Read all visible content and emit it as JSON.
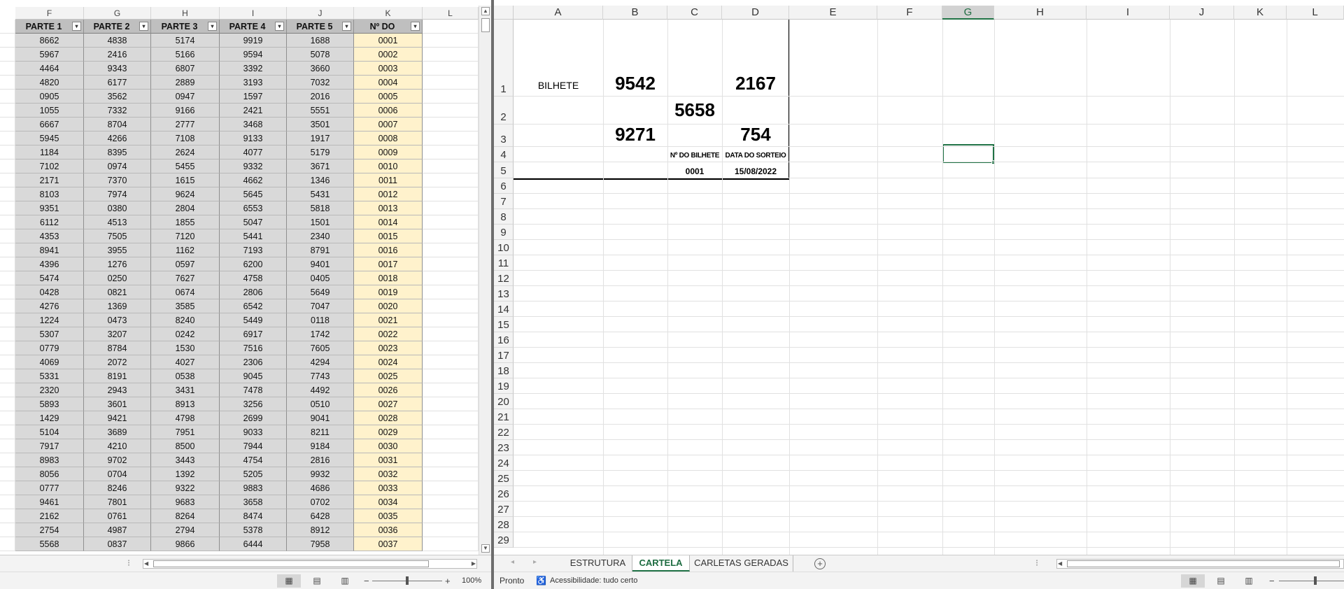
{
  "left_pane": {
    "columns": [
      "F",
      "G",
      "H",
      "I",
      "J",
      "K",
      "L"
    ],
    "headers": [
      "PARTE 1",
      "PARTE 2",
      "PARTE 3",
      "PARTE 4",
      "PARTE 5",
      "Nº DO BILHETE"
    ],
    "filter_glyph": "▾",
    "rows": [
      [
        "8662",
        "4838",
        "5174",
        "9919",
        "1688",
        "0001"
      ],
      [
        "5967",
        "2416",
        "5166",
        "9594",
        "5078",
        "0002"
      ],
      [
        "4464",
        "9343",
        "6807",
        "3392",
        "3660",
        "0003"
      ],
      [
        "4820",
        "6177",
        "2889",
        "3193",
        "7032",
        "0004"
      ],
      [
        "0905",
        "3562",
        "0947",
        "1597",
        "2016",
        "0005"
      ],
      [
        "1055",
        "7332",
        "9166",
        "2421",
        "5551",
        "0006"
      ],
      [
        "6667",
        "8704",
        "2777",
        "3468",
        "3501",
        "0007"
      ],
      [
        "5945",
        "4266",
        "7108",
        "9133",
        "1917",
        "0008"
      ],
      [
        "1184",
        "8395",
        "2624",
        "4077",
        "5179",
        "0009"
      ],
      [
        "7102",
        "0974",
        "5455",
        "9332",
        "3671",
        "0010"
      ],
      [
        "2171",
        "7370",
        "1615",
        "4662",
        "1346",
        "0011"
      ],
      [
        "8103",
        "7974",
        "9624",
        "5645",
        "5431",
        "0012"
      ],
      [
        "9351",
        "0380",
        "2804",
        "6553",
        "5818",
        "0013"
      ],
      [
        "6112",
        "4513",
        "1855",
        "5047",
        "1501",
        "0014"
      ],
      [
        "4353",
        "7505",
        "7120",
        "5441",
        "2340",
        "0015"
      ],
      [
        "8941",
        "3955",
        "1162",
        "7193",
        "8791",
        "0016"
      ],
      [
        "4396",
        "1276",
        "0597",
        "6200",
        "9401",
        "0017"
      ],
      [
        "5474",
        "0250",
        "7627",
        "4758",
        "0405",
        "0018"
      ],
      [
        "0428",
        "0821",
        "0674",
        "2806",
        "5649",
        "0019"
      ],
      [
        "4276",
        "1369",
        "3585",
        "6542",
        "7047",
        "0020"
      ],
      [
        "1224",
        "0473",
        "8240",
        "5449",
        "0118",
        "0021"
      ],
      [
        "5307",
        "3207",
        "0242",
        "6917",
        "1742",
        "0022"
      ],
      [
        "0779",
        "8784",
        "1530",
        "7516",
        "7605",
        "0023"
      ],
      [
        "4069",
        "2072",
        "4027",
        "2306",
        "4294",
        "0024"
      ],
      [
        "5331",
        "8191",
        "0538",
        "9045",
        "7743",
        "0025"
      ],
      [
        "2320",
        "2943",
        "3431",
        "7478",
        "4492",
        "0026"
      ],
      [
        "5893",
        "3601",
        "8913",
        "3256",
        "0510",
        "0027"
      ],
      [
        "1429",
        "9421",
        "4798",
        "2699",
        "9041",
        "0028"
      ],
      [
        "5104",
        "3689",
        "7951",
        "9033",
        "8211",
        "0029"
      ],
      [
        "7917",
        "4210",
        "8500",
        "7944",
        "9184",
        "0030"
      ],
      [
        "8983",
        "9702",
        "3443",
        "4754",
        "2816",
        "0031"
      ],
      [
        "8056",
        "0704",
        "1392",
        "5205",
        "9932",
        "0032"
      ],
      [
        "0777",
        "8246",
        "9322",
        "9883",
        "4686",
        "0033"
      ],
      [
        "9461",
        "7801",
        "9683",
        "3658",
        "0702",
        "0034"
      ],
      [
        "2162",
        "0761",
        "8264",
        "8474",
        "6428",
        "0035"
      ],
      [
        "2754",
        "4987",
        "2794",
        "5378",
        "8912",
        "0036"
      ],
      [
        "5568",
        "0837",
        "9866",
        "6444",
        "7958",
        "0037"
      ]
    ],
    "zoom_label": "100%",
    "zoom_value": 100
  },
  "right_pane": {
    "columns": [
      "A",
      "B",
      "C",
      "D",
      "E",
      "F",
      "G",
      "H",
      "I",
      "J",
      "K",
      "L"
    ],
    "selected_column": "G",
    "rows": [
      "1",
      "2",
      "3",
      "4",
      "5",
      "6",
      "7",
      "8",
      "9",
      "10",
      "11",
      "12",
      "13",
      "14",
      "15",
      "16",
      "17",
      "18",
      "19",
      "20",
      "21",
      "22",
      "23",
      "24",
      "25",
      "26",
      "27",
      "28",
      "29"
    ],
    "cartela": {
      "label": "BILHETE",
      "b1": "9542",
      "d1": "2167",
      "c2": "5658",
      "b3": "9271",
      "d3": "754",
      "ticket_header": "Nº DO BILHETE",
      "date_header": "DATA DO SORTEIO",
      "ticket_value": "0001",
      "date_value": "15/08/2022"
    },
    "sheet_tabs": [
      "ESTRUTURA",
      "CARTELA",
      "CARLETAS GERADAS"
    ],
    "active_tab": "CARTELA",
    "add_sheet_glyph": "+",
    "status": {
      "ready": "Pronto",
      "accessibility": "Acessibilidade: tudo certo"
    }
  },
  "icons": {
    "arrow_up": "▲",
    "arrow_down": "▼",
    "arrow_left": "◀",
    "arrow_right": "▶",
    "nav_prev": "◂",
    "nav_next": "▸",
    "normal_view": "▦",
    "page_layout_view": "▤",
    "page_break_view": "▥",
    "zoom_minus": "−",
    "zoom_plus": "+",
    "accessibility": "♿",
    "colon_handle": "⁝"
  }
}
